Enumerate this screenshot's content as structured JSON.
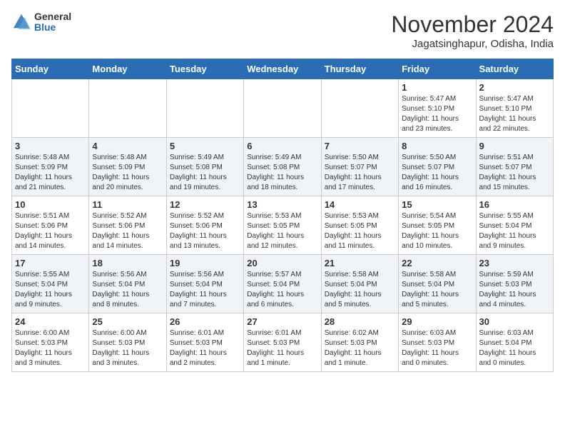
{
  "logo": {
    "general": "General",
    "blue": "Blue"
  },
  "title": "November 2024",
  "location": "Jagatsinghapur, Odisha, India",
  "headers": [
    "Sunday",
    "Monday",
    "Tuesday",
    "Wednesday",
    "Thursday",
    "Friday",
    "Saturday"
  ],
  "weeks": [
    [
      {
        "day": "",
        "info": ""
      },
      {
        "day": "",
        "info": ""
      },
      {
        "day": "",
        "info": ""
      },
      {
        "day": "",
        "info": ""
      },
      {
        "day": "",
        "info": ""
      },
      {
        "day": "1",
        "info": "Sunrise: 5:47 AM\nSunset: 5:10 PM\nDaylight: 11 hours\nand 23 minutes."
      },
      {
        "day": "2",
        "info": "Sunrise: 5:47 AM\nSunset: 5:10 PM\nDaylight: 11 hours\nand 22 minutes."
      }
    ],
    [
      {
        "day": "3",
        "info": "Sunrise: 5:48 AM\nSunset: 5:09 PM\nDaylight: 11 hours\nand 21 minutes."
      },
      {
        "day": "4",
        "info": "Sunrise: 5:48 AM\nSunset: 5:09 PM\nDaylight: 11 hours\nand 20 minutes."
      },
      {
        "day": "5",
        "info": "Sunrise: 5:49 AM\nSunset: 5:08 PM\nDaylight: 11 hours\nand 19 minutes."
      },
      {
        "day": "6",
        "info": "Sunrise: 5:49 AM\nSunset: 5:08 PM\nDaylight: 11 hours\nand 18 minutes."
      },
      {
        "day": "7",
        "info": "Sunrise: 5:50 AM\nSunset: 5:07 PM\nDaylight: 11 hours\nand 17 minutes."
      },
      {
        "day": "8",
        "info": "Sunrise: 5:50 AM\nSunset: 5:07 PM\nDaylight: 11 hours\nand 16 minutes."
      },
      {
        "day": "9",
        "info": "Sunrise: 5:51 AM\nSunset: 5:07 PM\nDaylight: 11 hours\nand 15 minutes."
      }
    ],
    [
      {
        "day": "10",
        "info": "Sunrise: 5:51 AM\nSunset: 5:06 PM\nDaylight: 11 hours\nand 14 minutes."
      },
      {
        "day": "11",
        "info": "Sunrise: 5:52 AM\nSunset: 5:06 PM\nDaylight: 11 hours\nand 14 minutes."
      },
      {
        "day": "12",
        "info": "Sunrise: 5:52 AM\nSunset: 5:06 PM\nDaylight: 11 hours\nand 13 minutes."
      },
      {
        "day": "13",
        "info": "Sunrise: 5:53 AM\nSunset: 5:05 PM\nDaylight: 11 hours\nand 12 minutes."
      },
      {
        "day": "14",
        "info": "Sunrise: 5:53 AM\nSunset: 5:05 PM\nDaylight: 11 hours\nand 11 minutes."
      },
      {
        "day": "15",
        "info": "Sunrise: 5:54 AM\nSunset: 5:05 PM\nDaylight: 11 hours\nand 10 minutes."
      },
      {
        "day": "16",
        "info": "Sunrise: 5:55 AM\nSunset: 5:04 PM\nDaylight: 11 hours\nand 9 minutes."
      }
    ],
    [
      {
        "day": "17",
        "info": "Sunrise: 5:55 AM\nSunset: 5:04 PM\nDaylight: 11 hours\nand 9 minutes."
      },
      {
        "day": "18",
        "info": "Sunrise: 5:56 AM\nSunset: 5:04 PM\nDaylight: 11 hours\nand 8 minutes."
      },
      {
        "day": "19",
        "info": "Sunrise: 5:56 AM\nSunset: 5:04 PM\nDaylight: 11 hours\nand 7 minutes."
      },
      {
        "day": "20",
        "info": "Sunrise: 5:57 AM\nSunset: 5:04 PM\nDaylight: 11 hours\nand 6 minutes."
      },
      {
        "day": "21",
        "info": "Sunrise: 5:58 AM\nSunset: 5:04 PM\nDaylight: 11 hours\nand 5 minutes."
      },
      {
        "day": "22",
        "info": "Sunrise: 5:58 AM\nSunset: 5:04 PM\nDaylight: 11 hours\nand 5 minutes."
      },
      {
        "day": "23",
        "info": "Sunrise: 5:59 AM\nSunset: 5:03 PM\nDaylight: 11 hours\nand 4 minutes."
      }
    ],
    [
      {
        "day": "24",
        "info": "Sunrise: 6:00 AM\nSunset: 5:03 PM\nDaylight: 11 hours\nand 3 minutes."
      },
      {
        "day": "25",
        "info": "Sunrise: 6:00 AM\nSunset: 5:03 PM\nDaylight: 11 hours\nand 3 minutes."
      },
      {
        "day": "26",
        "info": "Sunrise: 6:01 AM\nSunset: 5:03 PM\nDaylight: 11 hours\nand 2 minutes."
      },
      {
        "day": "27",
        "info": "Sunrise: 6:01 AM\nSunset: 5:03 PM\nDaylight: 11 hours\nand 1 minute."
      },
      {
        "day": "28",
        "info": "Sunrise: 6:02 AM\nSunset: 5:03 PM\nDaylight: 11 hours\nand 1 minute."
      },
      {
        "day": "29",
        "info": "Sunrise: 6:03 AM\nSunset: 5:03 PM\nDaylight: 11 hours\nand 0 minutes."
      },
      {
        "day": "30",
        "info": "Sunrise: 6:03 AM\nSunset: 5:04 PM\nDaylight: 11 hours\nand 0 minutes."
      }
    ]
  ]
}
